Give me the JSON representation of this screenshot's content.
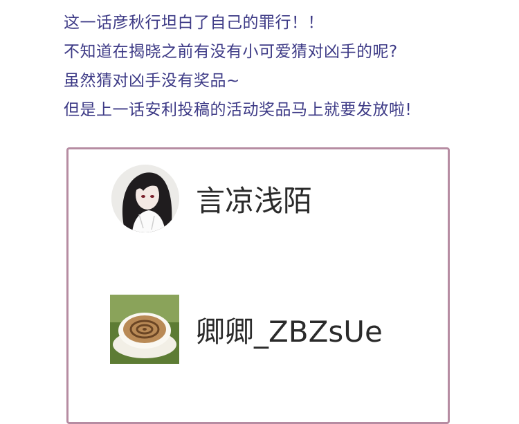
{
  "intro": {
    "lines": [
      "这一话彦秋行坦白了自己的罪行！！",
      "不知道在揭晓之前有没有小可爱猜对凶手的呢?",
      "虽然猜对凶手没有奖品~",
      "但是上一话安利投稿的活动奖品马上就要发放啦!"
    ],
    "color": "#3d3a86"
  },
  "winners": {
    "border_color": "#b68ca2",
    "users": [
      {
        "name": "言凉浅陌",
        "avatar": "anime-girl-avatar"
      },
      {
        "name": "卿卿_ZBZsUe",
        "avatar": "coffee-cup-avatar"
      }
    ]
  }
}
